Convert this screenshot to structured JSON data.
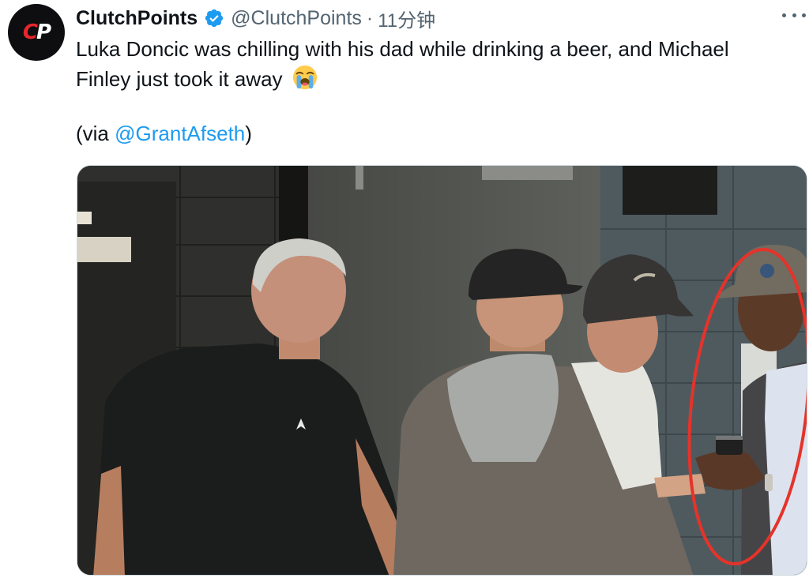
{
  "tweet": {
    "author_name": "ClutchPoints",
    "handle": "@ClutchPoints",
    "separator": "·",
    "time": "11分钟",
    "avatar_letters": {
      "first": "C",
      "second": "P"
    },
    "body_text": "Luka Doncic was chilling with his dad while drinking a beer, and Michael Finley just took it away",
    "emoji": "loudly-crying-face",
    "via_prefix": "(via ",
    "via_mention": "@GrantAfseth",
    "via_suffix": ")"
  },
  "media": {
    "description_icons": [
      "shirt-logo-icon"
    ],
    "highlight_color": "#e5332a"
  },
  "colors": {
    "link": "#1d9bf0",
    "secondary_text": "#536471",
    "verified": "#1d9bf0",
    "avatar_bg": "#0e0e10",
    "avatar_red": "#e8262c"
  }
}
